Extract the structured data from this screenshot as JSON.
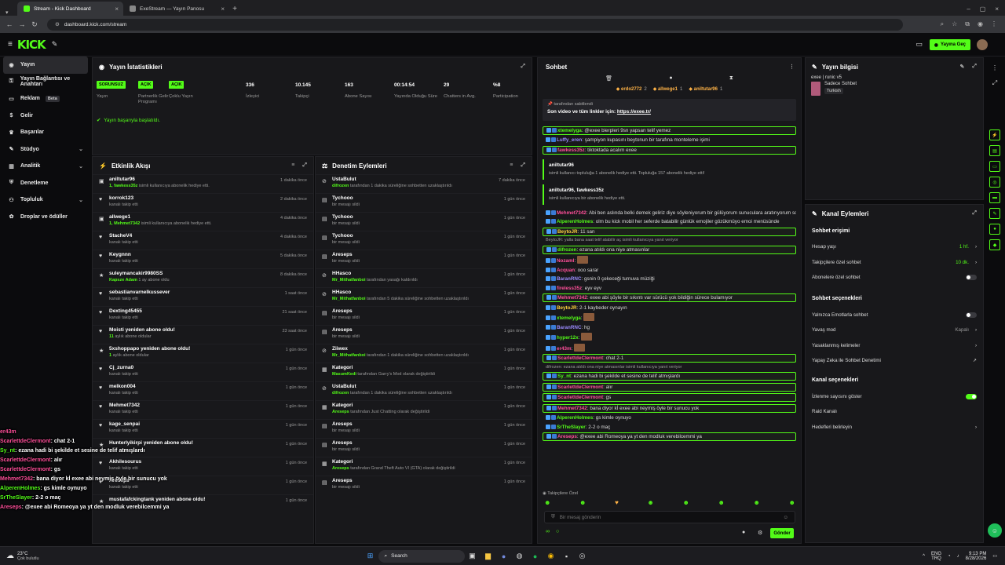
{
  "browser": {
    "tabs": [
      {
        "label": "Stream - Kick Dashboard",
        "active": true
      },
      {
        "label": "ExeStream — Yayın Panosu",
        "active": false
      }
    ],
    "url": "dashboard.kick.com/stream"
  },
  "topnav": {
    "logo": "KICK",
    "golive_label": "Yayına Geç"
  },
  "sidebar": {
    "items": [
      {
        "label": "Yayın",
        "icon": "broadcast-icon",
        "active": true
      },
      {
        "label": "Yayın Bağlantısı ve Anahtarı",
        "icon": "key-icon"
      },
      {
        "label": "Reklam",
        "icon": "ad-icon",
        "badge": "Beta"
      },
      {
        "label": "Gelir",
        "icon": "money-icon"
      },
      {
        "label": "Başarılar",
        "icon": "trophy-icon"
      },
      {
        "label": "Stüdyo",
        "icon": "studio-icon",
        "expand": true
      },
      {
        "label": "Analitik",
        "icon": "chart-icon",
        "expand": true
      },
      {
        "label": "Denetleme",
        "icon": "shield-icon"
      },
      {
        "label": "Topluluk",
        "icon": "people-icon",
        "expand": true
      },
      {
        "label": "Droplar ve ödüller",
        "icon": "gift-icon"
      }
    ]
  },
  "stats": {
    "title": "Yayın İstatistikleri",
    "status_msg": "Yayın başarıyla başlatıldı.",
    "items": [
      {
        "value": "SORUNSUZ",
        "label": "Yayın",
        "pill": true
      },
      {
        "value": "AÇIK",
        "label": "Partnerlik Gelir Programı",
        "pill": true
      },
      {
        "value": "AÇIK",
        "label": "Çoklu Yayın",
        "pill": true
      },
      {
        "value": "336",
        "label": "İzleyici"
      },
      {
        "value": "10.145",
        "label": "Takipçi"
      },
      {
        "value": "163",
        "label": "Abone Sayısı"
      },
      {
        "value": "00:14:54",
        "label": "Yayında Olduğu Süre"
      },
      {
        "value": "29",
        "label": "Chatters in Avg."
      },
      {
        "value": "%8",
        "label": "Participation"
      }
    ]
  },
  "activity": {
    "title": "Etkinlik Akışı",
    "rows": [
      {
        "icon": "gift-sub-icon",
        "name": "aniltutar96",
        "sub": "1, fawkess35z",
        "sub2": " isimli kullanıcıya abonelik hediye etti.",
        "time": "1 dakika önce"
      },
      {
        "icon": "heart-icon",
        "name": "korrok123",
        "sub": "",
        "sub2": "kanalı takip etti",
        "time": "2 dakika önce"
      },
      {
        "icon": "gift-sub-icon",
        "name": "allwege1",
        "sub": "1, Mehmet7342",
        "sub2": " isimli kullanıcıya abonelik hediye etti.",
        "time": "4 dakika önce"
      },
      {
        "icon": "heart-icon",
        "name": "StacheV4",
        "sub": "",
        "sub2": "kanalı takip etti",
        "time": "4 dakika önce"
      },
      {
        "icon": "heart-icon",
        "name": "Keygnnn",
        "sub": "",
        "sub2": "kanalı takip etti",
        "time": "5 dakika önce"
      },
      {
        "icon": "star-icon",
        "name": "suleymancakir9980SS",
        "sub": "Kapsze Adam",
        "sub2": " 1 ay abone oldu",
        "time": "8 dakika önce"
      },
      {
        "icon": "heart-icon",
        "name": "sebastianvarnelkussever",
        "sub": "",
        "sub2": "kanalı takip etti",
        "time": "1 saat önce"
      },
      {
        "icon": "heart-icon",
        "name": "Dexting45455",
        "sub": "",
        "sub2": "kanalı takip etti",
        "time": "21 saat önce"
      },
      {
        "icon": "heart-icon",
        "name": "Moisti yeniden abone oldu!",
        "sub": "11",
        "sub2": " aylık abone oldular",
        "time": "23 saat önce"
      },
      {
        "icon": "star-icon",
        "name": "5xshoppapo yeniden abone oldu!",
        "sub": "1",
        "sub2": " aylık abone oldular",
        "time": "1 gün önce"
      },
      {
        "icon": "heart-icon",
        "name": "Cj_zurna0",
        "sub": "",
        "sub2": "kanalı takip etti",
        "time": "1 gün önce"
      },
      {
        "icon": "heart-icon",
        "name": "melkon004",
        "sub": "",
        "sub2": "kanalı takip etti",
        "time": "1 gün önce"
      },
      {
        "icon": "heart-icon",
        "name": "Mehmet7342",
        "sub": "",
        "sub2": "kanalı takip etti",
        "time": "1 gün önce"
      },
      {
        "icon": "heart-icon",
        "name": "kage_senpai",
        "sub": "",
        "sub2": "kanalı takip etti",
        "time": "1 gün önce"
      },
      {
        "icon": "star-icon",
        "name": "Hunterlyikirpi yeniden abone oldu!",
        "sub": "",
        "sub2": "",
        "time": "1 gün önce"
      },
      {
        "icon": "heart-icon",
        "name": "Akhilesourus",
        "sub": "",
        "sub2": "kanalı takip etti",
        "time": "1 gün önce"
      },
      {
        "icon": "heart-icon",
        "name": "Areseps",
        "sub": "",
        "sub2": "kanalı takip etti",
        "time": "1 gün önce"
      },
      {
        "icon": "star-icon",
        "name": "mustafafckingtank yeniden abone oldu!",
        "sub": "",
        "sub2": "",
        "time": "1 gün önce"
      }
    ]
  },
  "moderation": {
    "title": "Denetim Eylemleri",
    "rows": [
      {
        "icon": "ban-icon",
        "name": "UstaBulut",
        "sub": "difrozen",
        "sub2": " tarafından 1 dakika süreliğine sohbetten uzaklaştırıldı",
        "time": "7 dakika önce"
      },
      {
        "icon": "trash-icon",
        "name": "Tychooo",
        "sub": "",
        "sub2": "bir mesajı sildi",
        "time": "1 gün önce"
      },
      {
        "icon": "trash-icon",
        "name": "Tychooo",
        "sub": "",
        "sub2": "bir mesajı sildi",
        "time": "1 gün önce"
      },
      {
        "icon": "trash-icon",
        "name": "Tychooo",
        "sub": "",
        "sub2": "bir mesajı sildi",
        "time": "1 gün önce"
      },
      {
        "icon": "trash-icon",
        "name": "Areseps",
        "sub": "",
        "sub2": "bir mesajı sildi",
        "time": "1 gün önce"
      },
      {
        "icon": "ban-icon",
        "name": "HHasco",
        "sub": "Mr_Mithatfanboi",
        "sub2": " tarafından yasağı kaldırıldı",
        "time": "1 gün önce"
      },
      {
        "icon": "ban-icon",
        "name": "HHasco",
        "sub": "Mr_Mithatfanboi",
        "sub2": " tarafından 5 dakika süreliğine sohbetten uzaklaştırıldı",
        "time": "1 gün önce"
      },
      {
        "icon": "trash-icon",
        "name": "Areseps",
        "sub": "",
        "sub2": "bir mesajı sildi",
        "time": "1 gün önce"
      },
      {
        "icon": "trash-icon",
        "name": "Areseps",
        "sub": "",
        "sub2": "bir mesajı sildi",
        "time": "1 gün önce"
      },
      {
        "icon": "ban-icon",
        "name": "Ziiwex",
        "sub": "Mr_Mithatfanboi",
        "sub2": " tarafından 1 dakika süreliğine sohbetten uzaklaştırıldı",
        "time": "1 gün önce"
      },
      {
        "icon": "category-icon",
        "name": "Kategori",
        "sub": "MasumKedi",
        "sub2": " tarafından Garry's Mod olarak değiştirildi",
        "time": "1 gün önce"
      },
      {
        "icon": "ban-icon",
        "name": "UstaBulut",
        "sub": "difrozen",
        "sub2": " tarafından 1 dakika süreliğine sohbetten uzaklaştırıldı",
        "time": "1 gün önce"
      },
      {
        "icon": "category-icon",
        "name": "Kategori",
        "sub": "Areseps",
        "sub2": " tarafından Just Chatting olarak değiştirildi",
        "time": "1 gün önce"
      },
      {
        "icon": "trash-icon",
        "name": "Areseps",
        "sub": "",
        "sub2": "bir mesajı sildi",
        "time": "1 gün önce"
      },
      {
        "icon": "trash-icon",
        "name": "Areseps",
        "sub": "",
        "sub2": "bir mesajı sildi",
        "time": "1 gün önce"
      },
      {
        "icon": "category-icon",
        "name": "Kategori",
        "sub": "Areseps",
        "sub2": " tarafından Grand Theft Auto VI (GTA) olarak değiştirildi",
        "time": "1 gün önce"
      },
      {
        "icon": "trash-icon",
        "name": "Areseps",
        "sub": "",
        "sub2": "bir mesajı sildi",
        "time": "1 gün önce"
      }
    ]
  },
  "chat": {
    "title": "Sohbet",
    "top_gifters": [
      {
        "name": "erdo2772",
        "count": "2"
      },
      {
        "name": "allwege1",
        "count": "1"
      },
      {
        "name": "aniltutar96",
        "count": "1"
      }
    ],
    "pinned_by": "tarafından sabitlendi",
    "pinned_text": "Son video ve tüm linkler için: ",
    "pinned_link": "https://exee.tr/",
    "messages": [
      {
        "user": "xtemelyga",
        "color": "#53fc18",
        "text": "@exee bierpleri 9sn yapsan telif yemez",
        "hl": true
      },
      {
        "user": "Luffy_eren",
        "color": "#9b8cff",
        "text": "şampiyon kupasını beytonun bir tarafına monteleme işimi"
      },
      {
        "user": "fawkess35z",
        "color": "#ff4f9a",
        "text": "tiktoktada acalım exee",
        "hl": true
      },
      {
        "user": "aniltutar96",
        "color": "#ffffff",
        "text": "isimli kullanıcı topluluğa 1 abonelik hediye etti. Topluluğa 157 abonelik hediye etti!",
        "gift": true
      },
      {
        "user": "aniltutar96, fawkess35z",
        "color": "#ffffff",
        "text": "isimli kullanıcıya bir abonelik hediye etti.",
        "gift": true
      },
      {
        "user": "Mehmet7342",
        "color": "#ff4f9a",
        "text": "Abi ben aslında belki demek geliriz diye söyleniyorum bir gülüyorum sunuculara aratırıyorum sonucu yok bulunmuyor lâkin"
      },
      {
        "user": "AlperenHolmes",
        "color": "#53fc18",
        "text": "olm bu kick mobil her seferde batabilir günlük emojiler gözükmüyo emoi menüsünde"
      },
      {
        "user": "BeytoJR",
        "color": "#ffd23f",
        "text": "11 san",
        "hl": true
      },
      {
        "user": "difrozen",
        "color": "#53fc18",
        "text": "ezana atıldı ona niye atmasınlar",
        "hl": true,
        "reply": "BeytoJR: yalla bana saat telif atabilir aç isimli kullanıcıya yanıt veriyor"
      },
      {
        "user": "Nozaml",
        "color": "#ff4f9a",
        "text": "",
        "emote": true
      },
      {
        "user": "Acquan",
        "color": "#ff4f9a",
        "text": "ooo sarar"
      },
      {
        "user": "BaranRNC",
        "color": "#9b8cff",
        "text": "gsnin 0 çekeceği turnuva müziği"
      },
      {
        "user": "fireless35z",
        "color": "#ff4f9a",
        "text": "eyv eyv"
      },
      {
        "user": "Mehmet7342",
        "color": "#ff4f9a",
        "text": "exee abi şöyle bir sıkıntı var sürücü yok bildiğin sürece bulamıyor",
        "hl": true
      },
      {
        "user": "BeytoJR",
        "color": "#ffd23f",
        "text": "2-1 kaybeder oynayın"
      },
      {
        "user": "xtemelyga",
        "color": "#53fc18",
        "text": "",
        "emote": true
      },
      {
        "user": "BaranRNC",
        "color": "#9b8cff",
        "text": "hg"
      },
      {
        "user": "hyper12x",
        "color": "#53fc18",
        "text": "",
        "emote": true
      },
      {
        "user": "er43m",
        "color": "#ff4f9a",
        "text": "",
        "emote": true
      },
      {
        "user": "ScarlettdeClermont",
        "color": "#ff4f9a",
        "text": "chat 2-1",
        "hl": true
      },
      {
        "user": "Sy_nt",
        "color": "#53fc18",
        "text": "ezana hadi bi şekilde et sesine de telif atmışlardı",
        "hl": true,
        "reply": "difrozen: ezana atıldı ona niye atmasınlar isimli kullanıcıya yanıt veriyor"
      },
      {
        "user": "ScarlettdeClermont",
        "color": "#ff4f9a",
        "text": "alır",
        "hl": true
      },
      {
        "user": "ScarlettdeClermont",
        "color": "#ff4f9a",
        "text": "gs",
        "hl": true
      },
      {
        "user": "Mehmet7342",
        "color": "#ff4f9a",
        "text": "bana diyor kİ exee abi neymiş öyle bir sunucu yok",
        "hl": true
      },
      {
        "user": "AlperenHolmes",
        "color": "#53fc18",
        "text": "gs kimle oynuyo"
      },
      {
        "user": "SrTheSlayer",
        "color": "#53fc18",
        "text": "2-2 o maç"
      },
      {
        "user": "Areseps",
        "color": "#ff4f9a",
        "text": "@exee abi Romeoya ya yt den modluk verebilcemmi ya",
        "hl": true
      }
    ],
    "mode_label": "Takipçilere Özel",
    "input_placeholder": "Bir mesaj gönderin",
    "send_label": "Gönder"
  },
  "stream_info": {
    "title": "Yayın bilgisi",
    "stream_title": "exee | runic v5",
    "category": "Sadece Sohbet",
    "language": "Turkish"
  },
  "channel_actions": {
    "title": "Kanal Eylemleri",
    "chat_access_title": "Sohbet erişimi",
    "rows1": [
      {
        "label": "Hesap yaşı",
        "value": "1 hf.",
        "type": "value"
      },
      {
        "label": "Takipçilere özel sohbet",
        "value": "10 dk.",
        "type": "value"
      },
      {
        "label": "Abonelere özel sohbet",
        "value": "",
        "type": "toggle-off"
      }
    ],
    "chat_options_title": "Sohbet seçenekleri",
    "rows2": [
      {
        "label": "Yalnızca Emotlarla sohbet",
        "value": "",
        "type": "toggle-off"
      },
      {
        "label": "Yavaş mod",
        "value": "Kapalı",
        "type": "value-grey"
      },
      {
        "label": "Yasaklanmış kelimeler",
        "value": "",
        "type": "chev"
      },
      {
        "label": "Yapay Zeka ile Sohbet Denetimi",
        "value": "",
        "type": "ext"
      }
    ],
    "channel_options_title": "Kanal seçenekleri",
    "rows3": [
      {
        "label": "İzlenme sayısını göster",
        "value": "",
        "type": "toggle-on"
      },
      {
        "label": "Raid Kanalı",
        "value": "",
        "type": "none"
      },
      {
        "label": "Hedefleri belirleyin",
        "value": "",
        "type": "chev"
      }
    ]
  },
  "overlay_chat": [
    {
      "user": "er43m",
      "color": "#ff4f9a",
      "text": ""
    },
    {
      "user": "ScarlettdeClermont",
      "color": "#ff4f9a",
      "text": ": chat 2-1"
    },
    {
      "user": "Sy_nt",
      "color": "#53fc18",
      "text": ": ezana hadi bi şekilde et sesine de telif atmışlardı"
    },
    {
      "user": "ScarlettdeClermont",
      "color": "#ff4f9a",
      "text": ": alır"
    },
    {
      "user": "ScarlettdeClermont",
      "color": "#ff4f9a",
      "text": ": gs"
    },
    {
      "user": "Mehmet7342",
      "color": "#ff4f9a",
      "text": ": bana diyor kİ exee abi neymiş öyle bir sunucu yok"
    },
    {
      "user": "AlperenHolmes",
      "color": "#53fc18",
      "text": ": gs kimle oynuyo"
    },
    {
      "user": "SrTheSlayer",
      "color": "#53fc18",
      "text": ": 2-2 o maç"
    },
    {
      "user": "Areseps",
      "color": "#ff4f9a",
      "text": ": @exee abi Romeoya ya yt den modluk verebilcemmi ya"
    }
  ],
  "taskbar": {
    "weather_temp": "23°C",
    "weather_desc": "Çok bulutlu",
    "search_label": "Search",
    "lang": "ENG",
    "lang2": "TRQ",
    "time": "9:13 PM",
    "date": "8/28/2026"
  }
}
